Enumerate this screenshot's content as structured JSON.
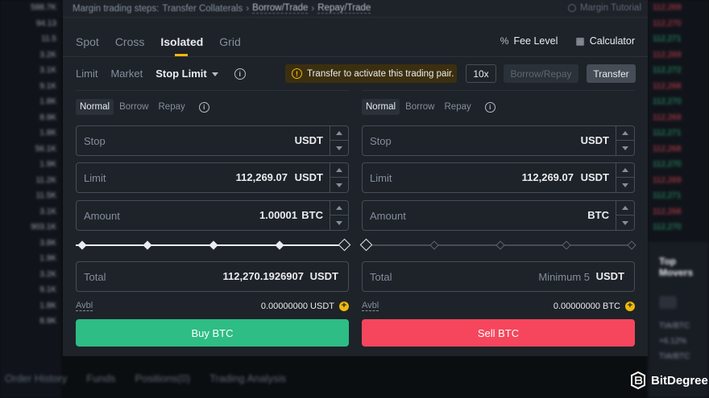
{
  "breadcrumb": {
    "prefix": "Margin trading steps:",
    "step1": "Transfer Collaterals",
    "step2": "Borrow/Trade",
    "step3": "Repay/Trade",
    "tutorial": "Margin Tutorial"
  },
  "tabs": [
    "Spot",
    "Cross",
    "Isolated",
    "Grid"
  ],
  "active_tab": "Isolated",
  "tools": {
    "fee_level": "Fee Level",
    "calculator": "Calculator"
  },
  "order_types": {
    "limit": "Limit",
    "market": "Market",
    "stop_limit": "Stop Limit"
  },
  "notice": "Transfer to activate this trading pair.",
  "leverage": "10x",
  "borrow_repay": "Borrow/Repay",
  "transfer": "Transfer",
  "mode_tabs": [
    "Normal",
    "Borrow",
    "Repay"
  ],
  "buy": {
    "stop_label": "Stop",
    "stop_unit": "USDT",
    "limit_label": "Limit",
    "limit_value": "112,269.07",
    "limit_unit": "USDT",
    "amount_label": "Amount",
    "amount_value": "1.00001",
    "amount_unit": "BTC",
    "slider_percent": 100,
    "total_label": "Total",
    "total_value": "112,270.1926907",
    "total_unit": "USDT",
    "avbl_label": "Avbl",
    "avbl_value": "0.00000000 USDT",
    "button": "Buy BTC"
  },
  "sell": {
    "stop_label": "Stop",
    "stop_unit": "USDT",
    "limit_label": "Limit",
    "limit_value": "112,269.07",
    "limit_unit": "USDT",
    "amount_label": "Amount",
    "amount_unit": "BTC",
    "slider_percent": 0,
    "total_label": "Total",
    "total_placeholder": "Minimum 5",
    "total_unit": "USDT",
    "avbl_label": "Avbl",
    "avbl_value": "0.00000000 BTC",
    "button": "Sell BTC"
  },
  "bottom_tabs": [
    "Order History",
    "Funds",
    "Positions(0)",
    "Trading Analysis"
  ],
  "right_panel_title": "Top Movers",
  "brand": "BitDegree",
  "colors": {
    "buy": "#2ebd85",
    "sell": "#f6465d",
    "accent": "#f0b90b",
    "panel": "#1e2329"
  }
}
